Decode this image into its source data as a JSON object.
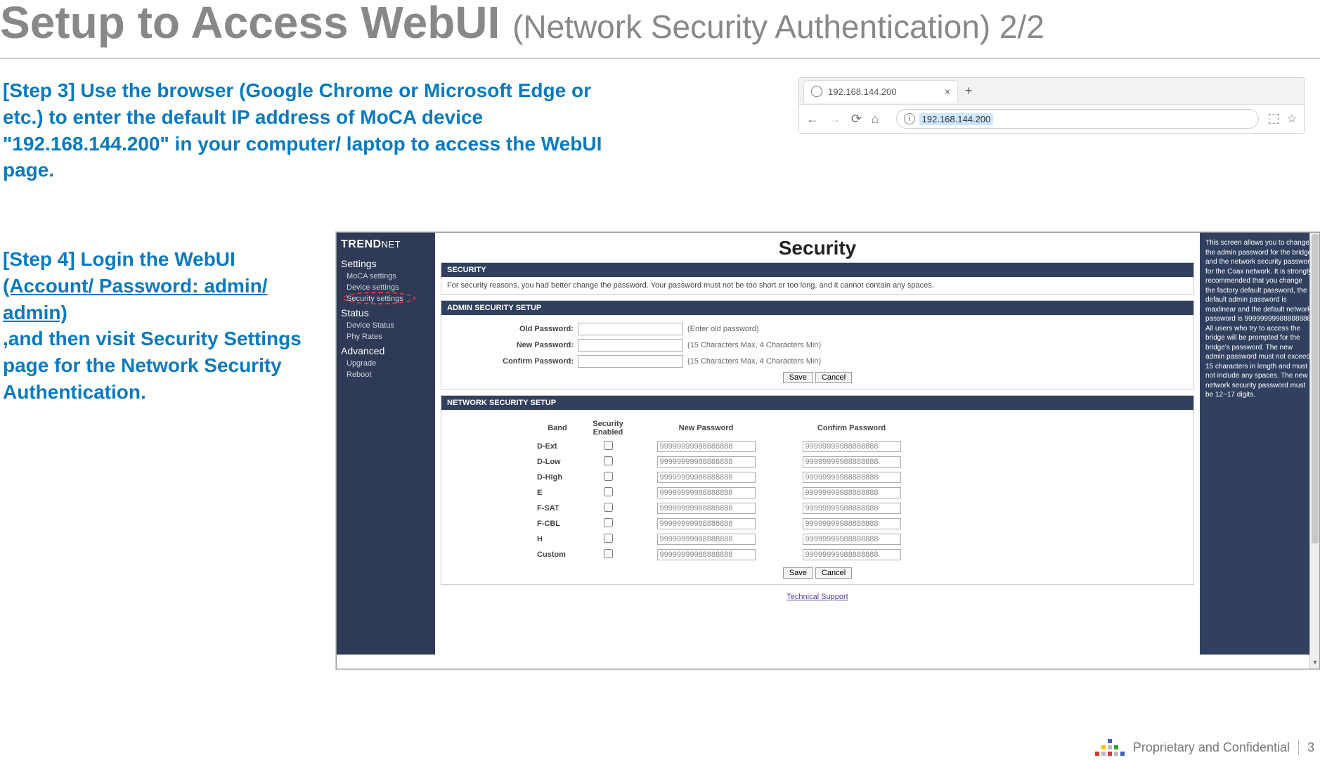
{
  "title": {
    "main": "Setup to Access WebUI ",
    "sub": "(Network Security Authentication) 2/2"
  },
  "step3": "[Step 3] Use the browser (Google Chrome or Microsoft Edge or etc.) to enter the default IP address of MoCA device \"192.168.144.200\" in your computer/ laptop to access the WebUI page.",
  "step4": {
    "l1": "[Step 4] Login the WebUI",
    "l2": "(Account/ Password: admin/ admin)",
    "l3": ",and then visit Security Settings page for the Network Security Authentication."
  },
  "browser": {
    "tab_title": "192.168.144.200",
    "new_tab": "+",
    "close_icon": "×",
    "nav": {
      "back": "←",
      "fwd": "→",
      "reload": "⟳",
      "home": "⌂"
    },
    "info": "i",
    "address": "192.168.144.200",
    "star": "☆"
  },
  "webui": {
    "brand_a": "TREND",
    "brand_b": "NET",
    "sidebar": {
      "settings_head": "Settings",
      "moca": "MoCA settings",
      "device": "Device settings",
      "security": "Security settings",
      "status_head": "Status",
      "devstatus": "Device Status",
      "phy": "Phy Rates",
      "adv_head": "Advanced",
      "upgrade": "Upgrade",
      "reboot": "Reboot"
    },
    "page_title": "Security",
    "sec_panel": {
      "head": "SECURITY",
      "body": "For security reasons, you had better change the password. Your password must not be too short or too long, and it cannot contain any spaces."
    },
    "admin_panel": {
      "head": "ADMIN SECURITY SETUP",
      "old_label": "Old Password:",
      "old_hint": "(Enter old password)",
      "new_label": "New Password:",
      "new_hint": "(15 Characters Max, 4 Characters Min)",
      "conf_label": "Confirm Password:",
      "conf_hint": "(15 Characters Max, 4 Characters Min)",
      "save": "Save",
      "cancel": "Cancel"
    },
    "net_panel": {
      "head": "NETWORK SECURITY SETUP",
      "cols": {
        "band": "Band",
        "sec": "Security Enabled",
        "np": "New Password",
        "cp": "Confirm Password"
      },
      "rows": [
        {
          "band": "D-Ext",
          "np": "99999999988888888",
          "cp": "99999999988888888"
        },
        {
          "band": "D-Low",
          "np": "99999999988888888",
          "cp": "99999999988888888"
        },
        {
          "band": "D-High",
          "np": "99999999988888888",
          "cp": "99999999988888888"
        },
        {
          "band": "E",
          "np": "99999999988888888",
          "cp": "99999999988888888"
        },
        {
          "band": "F-SAT",
          "np": "99999999988888888",
          "cp": "99999999988888888"
        },
        {
          "band": "F-CBL",
          "np": "99999999988888888",
          "cp": "99999999988888888"
        },
        {
          "band": "H",
          "np": "99999999988888888",
          "cp": "99999999988888888"
        },
        {
          "band": "Custom",
          "np": "99999999988888888",
          "cp": "99999999988888888"
        }
      ],
      "save": "Save",
      "cancel": "Cancel"
    },
    "help": "This screen allows you to change the admin password for the bridge and the network security password for the Coax network. It is strongly recommended that you change the factory default password, the default admin password is maxlinear and the default network password is 99999999988888888. All users who try to access the bridge will be prompted for the bridge's password. The new admin password must not exceed 15 characters in length and must not include any spaces. The new network security password must be 12~17 digits.",
    "ts_link": "Technical Support"
  },
  "footer": {
    "text": "Proprietary and Confidential",
    "page": "3"
  }
}
